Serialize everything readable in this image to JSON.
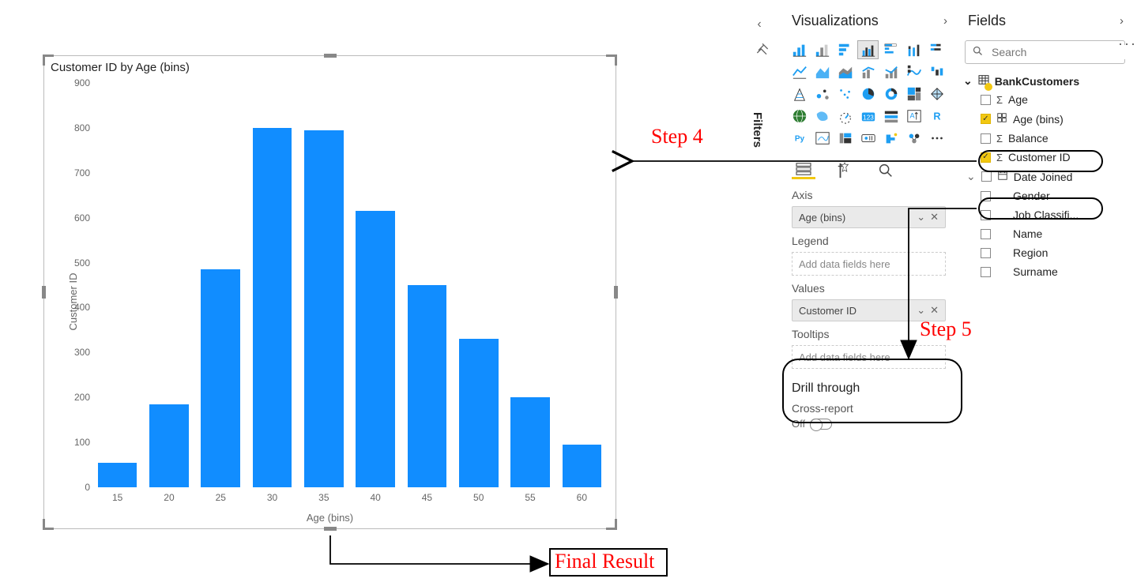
{
  "annotations": {
    "step4": "Step 4",
    "step5": "Step 5",
    "final": "Final Result"
  },
  "chart_visual": {
    "title": "Customer ID by Age (bins)",
    "ylabel": "Customer ID",
    "xlabel": "Age (bins)",
    "action_dots": "···"
  },
  "chart_data": {
    "type": "bar",
    "title": "Customer ID by Age (bins)",
    "xlabel": "Age (bins)",
    "ylabel": "Customer ID",
    "ylim": [
      0,
      900
    ],
    "yticks": [
      0,
      100,
      200,
      300,
      400,
      500,
      600,
      700,
      800,
      900
    ],
    "categories": [
      "15",
      "20",
      "25",
      "30",
      "35",
      "40",
      "45",
      "50",
      "55",
      "60"
    ],
    "values": [
      55,
      185,
      485,
      800,
      795,
      615,
      450,
      330,
      200,
      95
    ]
  },
  "filters_rail": {
    "label": "Filters"
  },
  "viz_panel": {
    "title": "Visualizations",
    "mode_tabs": {
      "fields": "Fields",
      "format": "Format",
      "analytics": "Analytics"
    },
    "wells": {
      "axis": {
        "label": "Axis",
        "item": "Age (bins)"
      },
      "legend": {
        "label": "Legend",
        "placeholder": "Add data fields here"
      },
      "values": {
        "label": "Values",
        "item": "Customer ID"
      },
      "tooltips": {
        "label": "Tooltips",
        "placeholder": "Add data fields here"
      }
    },
    "drill": {
      "title": "Drill through",
      "crossreport": "Cross-report",
      "off": "Off"
    }
  },
  "fields_panel": {
    "title": "Fields",
    "search_placeholder": "Search",
    "table": "BankCustomers",
    "rows": {
      "age": "Age",
      "age_bins": "Age (bins)",
      "balance": "Balance",
      "customer_id": "Customer ID",
      "date_joined": "Date Joined",
      "gender": "Gender",
      "job": "Job Classifi...",
      "name": "Name",
      "region": "Region",
      "surname": "Surname"
    }
  }
}
